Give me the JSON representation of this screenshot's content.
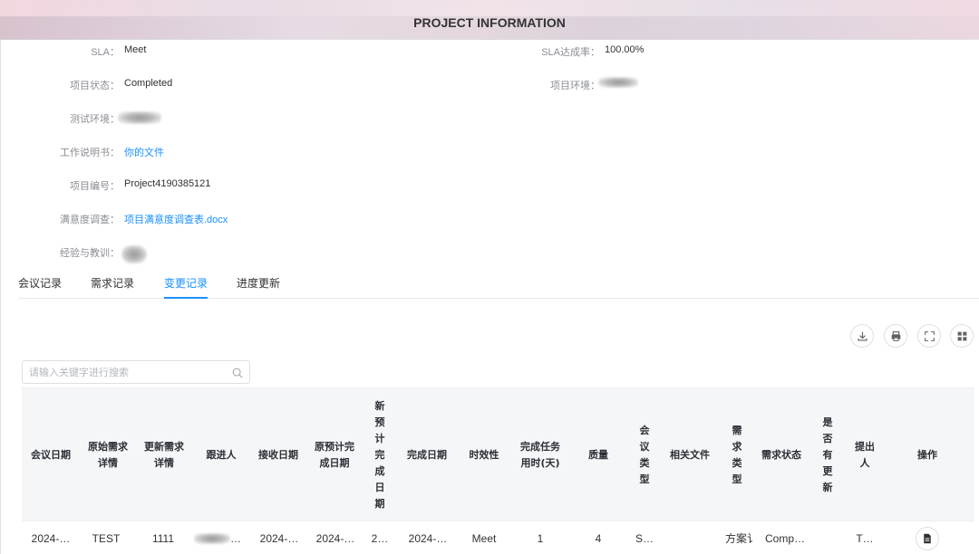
{
  "header": {
    "title": "PROJECT INFORMATION"
  },
  "info": {
    "sla_label": "SLA：",
    "sla_value": "Meet",
    "sla_rate_label": "SLA达成率：",
    "sla_rate_value": "100.00%",
    "status_label": "项目状态：",
    "status_value": "Completed",
    "env_label": "项目环境：",
    "test_env_label": "测试环境：",
    "sow_label": "工作说明书：",
    "sow_value": "你的文件",
    "project_no_label": "项目编号：",
    "project_no_value": "Project4190385121",
    "survey_label": "满意度调查：",
    "survey_value": "项目满意度调查表.docx",
    "lessons_label": "经验与教训："
  },
  "tabs": [
    "会议记录",
    "需求记录",
    "变更记录",
    "进度更新"
  ],
  "active_tab": 2,
  "toolbar": {
    "icons": [
      "download-icon",
      "print-icon",
      "fullscreen-icon",
      "column-settings-icon"
    ]
  },
  "search": {
    "placeholder": "请输入关键字进行搜索"
  },
  "table": {
    "columns": [
      "会议日期",
      "原始需求详情",
      "更新需求详情",
      "跟进人",
      "接收日期",
      "原预计完成日期",
      "新预计完成日期",
      "完成日期",
      "时效性",
      "完成任务用时(天)",
      "质量",
      "会议类型",
      "相关文件",
      "需求类型",
      "需求状态",
      "是否有更新",
      "提出人",
      "操作"
    ],
    "rows": [
      [
        "2024-…",
        "TEST",
        "1111",
        "…",
        "2024-…",
        "2024-…",
        "2…",
        "2024-…",
        "Meet",
        "1",
        "4",
        "S…",
        "",
        "方案讠",
        "Comp…",
        "",
        "T…",
        ""
      ]
    ]
  }
}
